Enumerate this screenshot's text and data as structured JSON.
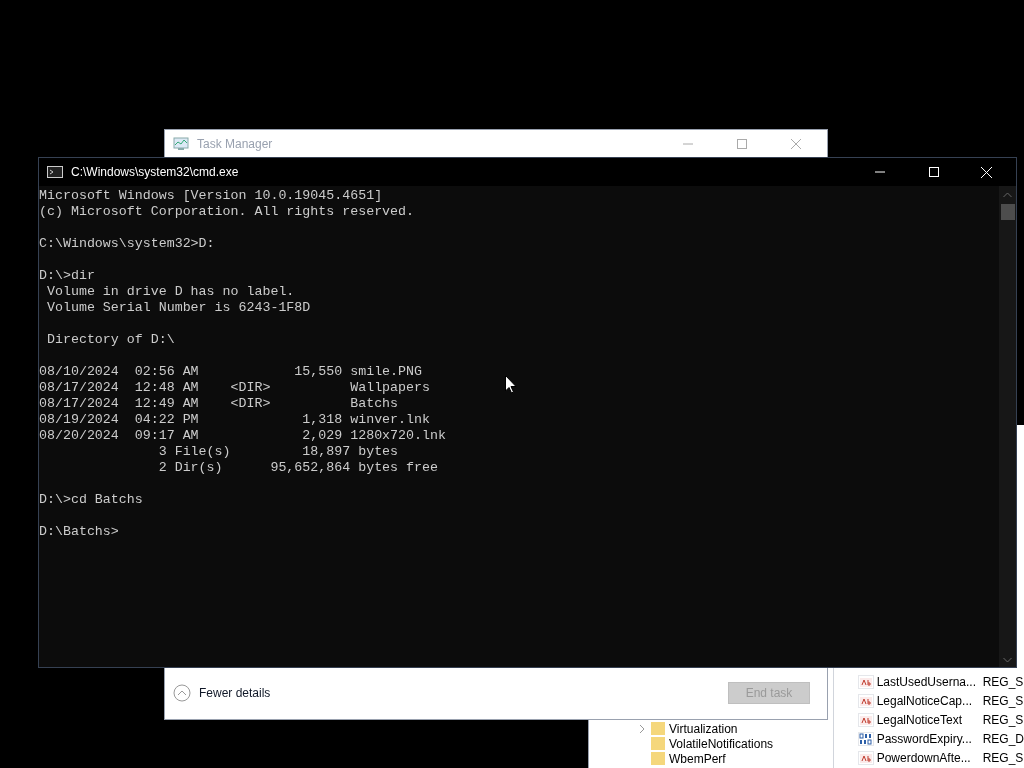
{
  "registry_editor": {
    "tree_items": [
      {
        "label": "Virtualization",
        "expanded": false
      },
      {
        "label": "VolatileNotifications"
      },
      {
        "label": "WbemPerf"
      }
    ],
    "values": [
      {
        "kind": "string",
        "name": "LastUsedUserna...",
        "type": "REG_S"
      },
      {
        "kind": "string",
        "name": "LegalNoticeCap...",
        "type": "REG_S"
      },
      {
        "kind": "string",
        "name": "LegalNoticeText",
        "type": "REG_S"
      },
      {
        "kind": "binary",
        "name": "PasswordExpiry...",
        "type": "REG_D"
      },
      {
        "kind": "string",
        "name": "PowerdownAfte...",
        "type": "REG_S"
      }
    ]
  },
  "task_manager": {
    "title": "Task Manager",
    "details_toggle": "Fewer details",
    "end_task": {
      "label": "End task",
      "disabled": true
    }
  },
  "console": {
    "title": "C:\\Windows\\system32\\cmd.exe",
    "blocks": [
      [
        "Microsoft Windows [Version 10.0.19045.4651]",
        "(c) Microsoft Corporation. All rights reserved."
      ],
      [
        "C:\\Windows\\system32>D:"
      ],
      [
        "D:\\>dir",
        " Volume in drive D has no label.",
        " Volume Serial Number is 6243-1F8D"
      ],
      [
        " Directory of D:\\"
      ],
      [
        "08/10/2024  02:56 AM            15,550 smile.PNG",
        "08/17/2024  12:48 AM    <DIR>          Wallpapers",
        "08/17/2024  12:49 AM    <DIR>          Batchs",
        "08/19/2024  04:22 PM             1,318 winver.lnk",
        "08/20/2024  09:17 AM             2,029 1280x720.lnk",
        "               3 File(s)         18,897 bytes",
        "               2 Dir(s)      95,652,864 bytes free"
      ],
      [
        "D:\\>cd Batchs"
      ],
      [
        "D:\\Batchs>"
      ]
    ]
  }
}
